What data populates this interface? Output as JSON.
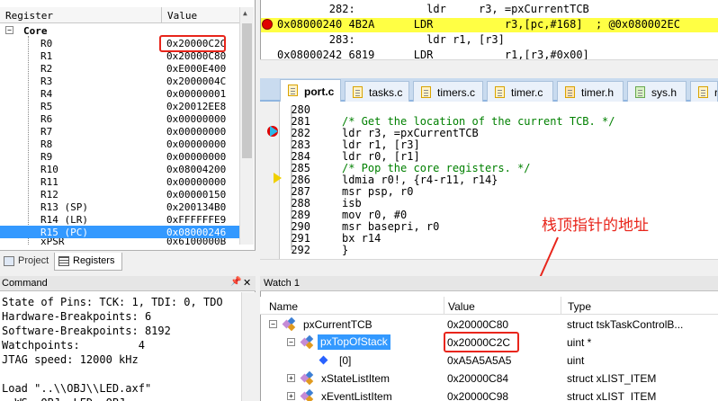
{
  "registers": {
    "header": {
      "col_register": "Register",
      "col_value": "Value"
    },
    "group": "Core",
    "items": [
      {
        "name": "R0",
        "value": "0x20000C2C"
      },
      {
        "name": "R1",
        "value": "0x20000C80"
      },
      {
        "name": "R2",
        "value": "0xE000E400"
      },
      {
        "name": "R3",
        "value": "0x2000004C"
      },
      {
        "name": "R4",
        "value": "0x00000001"
      },
      {
        "name": "R5",
        "value": "0x20012EE8"
      },
      {
        "name": "R6",
        "value": "0x00000000"
      },
      {
        "name": "R7",
        "value": "0x00000000"
      },
      {
        "name": "R8",
        "value": "0x00000000"
      },
      {
        "name": "R9",
        "value": "0x00000000"
      },
      {
        "name": "R10",
        "value": "0x08004200"
      },
      {
        "name": "R11",
        "value": "0x00000000"
      },
      {
        "name": "R12",
        "value": "0x00000150"
      },
      {
        "name": "R13 (SP)",
        "value": "0x200134B0"
      },
      {
        "name": "R14 (LR)",
        "value": "0xFFFFFFE9"
      },
      {
        "name": "R15 (PC)",
        "value": "0x08000246"
      },
      {
        "name": "xPSR",
        "value": "0x6100000B"
      }
    ],
    "tabs": {
      "project": "Project",
      "registers": "Registers"
    }
  },
  "command": {
    "title": "Command",
    "lines": [
      "State of Pins: TCK: 1, TDI: 0, TDO",
      "Hardware-Breakpoints: 6",
      "Software-Breakpoints: 8192",
      "Watchpoints:         4",
      "JTAG speed: 12000 kHz",
      "",
      "Load \"..\\\\OBJ\\\\LED.axf\"",
      "  WS  OBJ  LED  OBJ  ..  "
    ]
  },
  "disassembly": {
    "lines": [
      {
        "text": "        282:           ldr     r3, =pxCurrentTCB",
        "highlight": false
      },
      {
        "text": "0x08000240 4B2A      LDR           r3,[pc,#168]  ; @0x080002EC",
        "highlight": true
      },
      {
        "text": "        283:           ldr r1, [r3]",
        "highlight": false
      },
      {
        "text": "0x08000242 6819      LDR           r1,[r3,#0x00]",
        "highlight": false
      }
    ]
  },
  "file_tabs": [
    {
      "label": "port.c",
      "active": true,
      "kind": "c"
    },
    {
      "label": "tasks.c",
      "active": false,
      "kind": "c"
    },
    {
      "label": "timers.c",
      "active": false,
      "kind": "c"
    },
    {
      "label": "timer.c",
      "active": false,
      "kind": "c"
    },
    {
      "label": "timer.h",
      "active": false,
      "kind": "h"
    },
    {
      "label": "sys.h",
      "active": false,
      "kind": "s"
    },
    {
      "label": "r",
      "active": false,
      "kind": "c"
    }
  ],
  "editor": {
    "lines": [
      {
        "n": "280",
        "code": "",
        "comment": false
      },
      {
        "n": "281",
        "code": "/* Get the location of the current TCB. */",
        "comment": true
      },
      {
        "n": "282",
        "code": "ldr r3, =pxCurrentTCB",
        "comment": false
      },
      {
        "n": "283",
        "code": "ldr r1, [r3]",
        "comment": false
      },
      {
        "n": "284",
        "code": "ldr r0, [r1]",
        "comment": false
      },
      {
        "n": "285",
        "code": "/* Pop the core registers. */",
        "comment": true
      },
      {
        "n": "286",
        "code": "ldmia r0!, {r4-r11, r14}",
        "comment": false
      },
      {
        "n": "287",
        "code": "msr psp, r0",
        "comment": false
      },
      {
        "n": "288",
        "code": "isb",
        "comment": false
      },
      {
        "n": "289",
        "code": "mov r0, #0",
        "comment": false
      },
      {
        "n": "290",
        "code": "msr basepri, r0",
        "comment": false
      },
      {
        "n": "291",
        "code": "bx r14",
        "comment": false
      },
      {
        "n": "292",
        "code": "}",
        "comment": false
      }
    ]
  },
  "annotation": "栈顶指针的地址",
  "watch": {
    "title": "Watch 1",
    "headers": {
      "name": "Name",
      "value": "Value",
      "type": "Type"
    },
    "rows": [
      {
        "name": "pxCurrentTCB",
        "value": "0x20000C80",
        "type": "struct tskTaskControlB..."
      },
      {
        "name": "pxTopOfStack",
        "value": "0x20000C2C",
        "type": "uint *"
      },
      {
        "name": "[0]",
        "value": "0xA5A5A5A5",
        "type": "uint"
      },
      {
        "name": "xStateListItem",
        "value": "0x20000C84",
        "type": "struct xLIST_ITEM"
      },
      {
        "name": "xEventListItem",
        "value": "0x20000C98",
        "type": "struct xLIST_ITEM"
      }
    ]
  },
  "colors": {
    "highlight_box": "#e8251b",
    "selection": "#3399ff",
    "current_line": "#ffff44"
  }
}
